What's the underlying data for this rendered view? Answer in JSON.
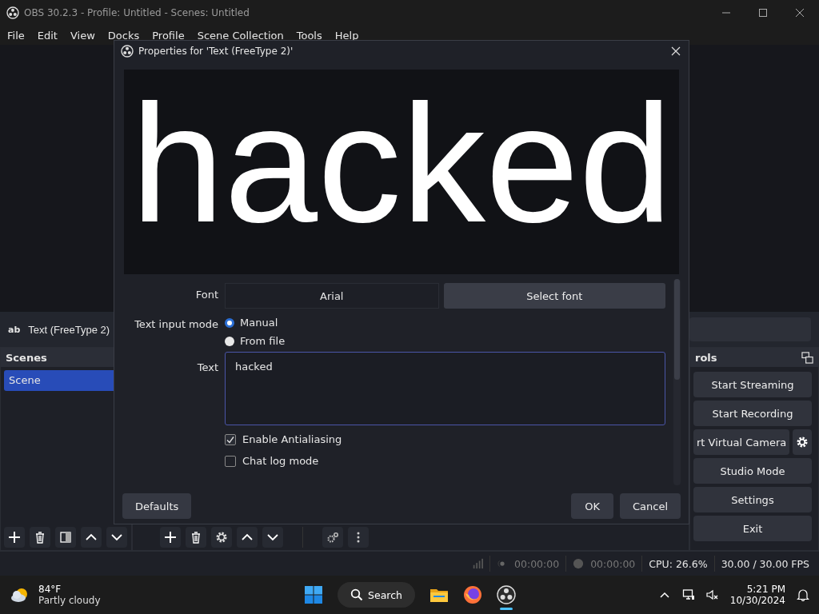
{
  "window": {
    "title": "OBS 30.2.3 - Profile: Untitled - Scenes: Untitled"
  },
  "menu": [
    "File",
    "Edit",
    "View",
    "Docks",
    "Profile",
    "Scene Collection",
    "Tools",
    "Help"
  ],
  "source_bar": {
    "icon_text": "ab",
    "name": "Text (FreeType 2)"
  },
  "scenes": {
    "title": "Scenes",
    "items": [
      {
        "label": "Scene",
        "selected": true
      }
    ]
  },
  "controls": {
    "title": "rols",
    "buttons": [
      {
        "kind": "plain",
        "label": "Start Streaming"
      },
      {
        "kind": "plain",
        "label": "Start Recording"
      },
      {
        "kind": "with-settings",
        "label": "rt Virtual Camera"
      },
      {
        "kind": "plain",
        "label": "Studio Mode"
      },
      {
        "kind": "plain",
        "label": "Settings"
      },
      {
        "kind": "plain",
        "label": "Exit"
      }
    ]
  },
  "status_bar": {
    "stream_time": "00:00:00",
    "record_time": "00:00:00",
    "cpu": "CPU: 26.6%",
    "fps": "30.00 / 30.00 FPS"
  },
  "dialog": {
    "title": "Properties for 'Text (FreeType 2)'",
    "preview_text": "hacked",
    "font_label": "Font",
    "font_value": "Arial",
    "select_font": "Select font",
    "input_mode_label": "Text input mode",
    "input_modes": [
      {
        "label": "Manual",
        "selected": true
      },
      {
        "label": "From file",
        "selected": false
      }
    ],
    "text_label": "Text",
    "text_value": "hacked",
    "options": [
      {
        "label": "Enable Antialiasing",
        "checked": true
      },
      {
        "label": "Chat log mode",
        "checked": false
      }
    ],
    "defaults": "Defaults",
    "ok": "OK",
    "cancel": "Cancel"
  },
  "taskbar": {
    "temperature": "84°F",
    "weather": "Partly cloudy",
    "search": "Search",
    "time": "5:21 PM",
    "date": "10/30/2024"
  }
}
